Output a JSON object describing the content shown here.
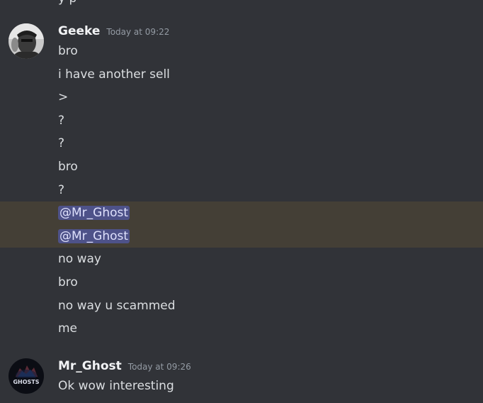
{
  "previous_message_partial": "y                    p",
  "messages": [
    {
      "author": "Geeke",
      "timestamp": "Today at 09:22",
      "avatar_icon": "user-avatar-geeke-icon",
      "lines": [
        {
          "text": "bro"
        },
        {
          "text": "i have another sell"
        },
        {
          "text": ">"
        },
        {
          "text": "?"
        },
        {
          "text": "?"
        },
        {
          "text": "bro"
        },
        {
          "text": "?"
        },
        {
          "mention": "@Mr_Ghost",
          "highlighted": true
        },
        {
          "mention": "@Mr_Ghost",
          "highlighted": true
        },
        {
          "text": "no way"
        },
        {
          "text": "bro"
        },
        {
          "text": "no way u scammed"
        },
        {
          "text": "me"
        }
      ]
    },
    {
      "author": "Mr_Ghost",
      "timestamp": "Today at 09:26",
      "avatar_icon": "ghosts-logo-icon",
      "avatar_text": "GHOSTS",
      "lines": [
        {
          "text": "Ok wow interesting"
        }
      ]
    }
  ],
  "colors": {
    "background": "#313338",
    "text": "#dbdee1",
    "username": "#f2f3f5",
    "timestamp": "#949ba4",
    "highlight_row": "#443f36",
    "mention_bg": "#4e5289",
    "mention_text": "#dee0fc"
  }
}
